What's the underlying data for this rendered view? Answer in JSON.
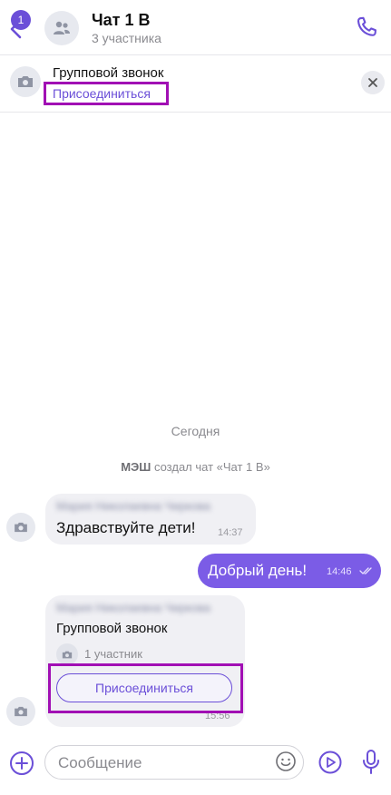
{
  "header": {
    "unread_badge": "1",
    "title": "Чат 1 В",
    "subtitle": "3 участника"
  },
  "call_banner": {
    "title": "Групповой звонок",
    "join_label": "Присоединиться"
  },
  "chat": {
    "day_label": "Сегодня",
    "system_actor": "МЭШ",
    "system_text": " создал чат «Чат 1 В»",
    "messages": [
      {
        "direction": "in",
        "sender": "Мария Николаевна Чиркова",
        "text": "Здравствуйте дети!",
        "time": "14:37"
      },
      {
        "direction": "out",
        "text": "Добрый день!",
        "time": "14:46"
      },
      {
        "direction": "in",
        "type": "call",
        "sender": "Мария Николаевна Чиркова",
        "title": "Групповой звонок",
        "participants": "1 участник",
        "join_label": "Присоединиться",
        "time": "15:56"
      }
    ]
  },
  "composer": {
    "placeholder": "Сообщение"
  },
  "colors": {
    "accent": "#6b4fd8",
    "outgoing_bubble": "#7b5ce6",
    "incoming_bubble": "#f0f0f4",
    "highlight_frame": "#a10fb4"
  },
  "icons": {
    "back": "chevron-left-icon",
    "call": "phone-icon",
    "group": "people-icon",
    "avatar": "camera-icon",
    "close": "close-icon",
    "attach": "plus-circle-icon",
    "emoji": "smile-icon",
    "video_note": "play-circle-icon",
    "mic": "microphone-icon",
    "read": "double-check-icon"
  }
}
